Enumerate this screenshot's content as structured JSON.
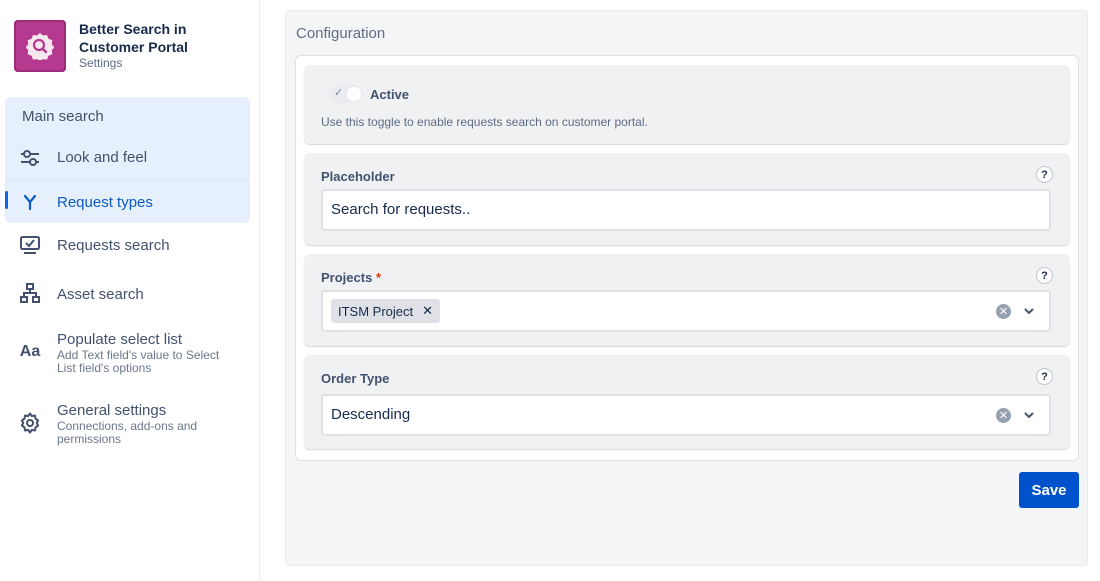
{
  "brand": {
    "title": "Better Search in Customer Portal",
    "subtitle": "Settings",
    "logo_color": "#b5398f"
  },
  "sidebar": {
    "group_title": "Main search",
    "items": [
      {
        "label": "Look and feel",
        "icon": "sliders-icon"
      },
      {
        "label": "Request types",
        "icon": "fork-icon",
        "active": true
      },
      {
        "label": "Requests search",
        "icon": "monitor-check-icon"
      },
      {
        "label": "Asset search",
        "icon": "hierarchy-icon"
      },
      {
        "label": "Populate select list",
        "description": "Add Text field's value to Select List field's options",
        "icon": "text-aa-icon"
      },
      {
        "label": "General settings",
        "description": "Connections, add-ons and permissions",
        "icon": "gear-icon"
      }
    ]
  },
  "config": {
    "title": "Configuration",
    "active": {
      "label": "Active",
      "description": "Use this toggle to enable requests search on customer portal.",
      "enabled": false
    },
    "placeholder": {
      "label": "Placeholder",
      "value": "Search for requests..",
      "help": "?"
    },
    "projects": {
      "label": "Projects",
      "required_mark": "*",
      "chips": [
        "ITSM Project"
      ],
      "help": "?"
    },
    "order_type": {
      "label": "Order Type",
      "value": "Descending",
      "help": "?"
    },
    "save_label": "Save"
  },
  "colors": {
    "accent": "#0052cc",
    "active_nav": "#0c5ac4",
    "nav_highlight": "#e6f0fc"
  }
}
